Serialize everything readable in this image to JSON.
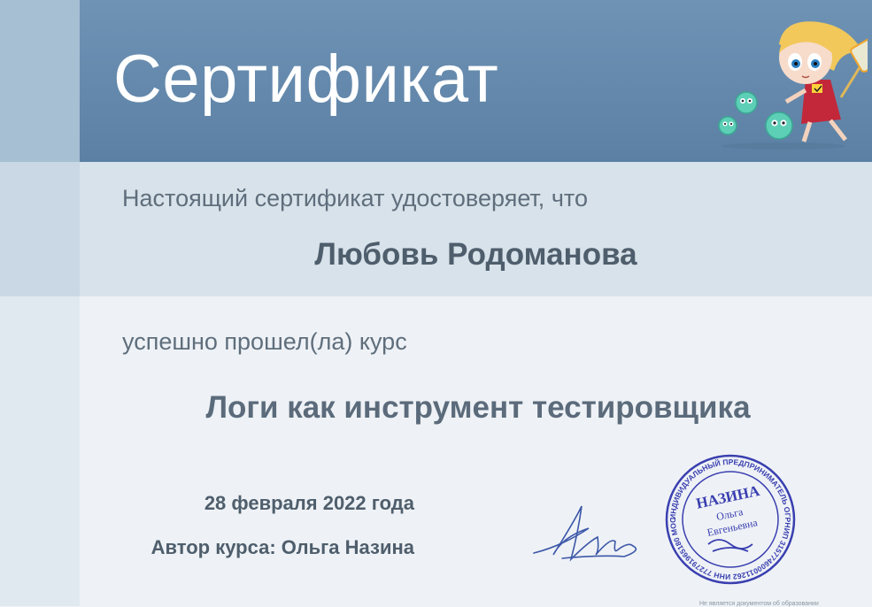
{
  "certificate": {
    "title": "Сертификат",
    "intro": "Настоящий сертификат удостоверяет, что",
    "recipient": "Любовь Родоманова",
    "passed_text": "успешно прошел(ла) курс",
    "course_name": "Логи как инструмент тестировщика",
    "date": "28 февраля 2022 года",
    "author": "Автор курса: Ольга Назина",
    "footnote": "Не является документом об образовании"
  },
  "stamp": {
    "outer_text": "ИНДИВИДУАЛЬНЫЙ ПРЕДПРИНИМАТЕЛЬ ОГРНИП 315774600011262 ИНН 772791965180 МОСКВА",
    "surname": "НАЗИНА",
    "first_name": "Ольга",
    "patronymic": "Евгеньевна"
  },
  "colors": {
    "header_blue": "#6f93b5",
    "band_blue": "#d8e2ea",
    "text_gray": "#5f6e7c",
    "stamp_blue": "#3a3fb0"
  }
}
